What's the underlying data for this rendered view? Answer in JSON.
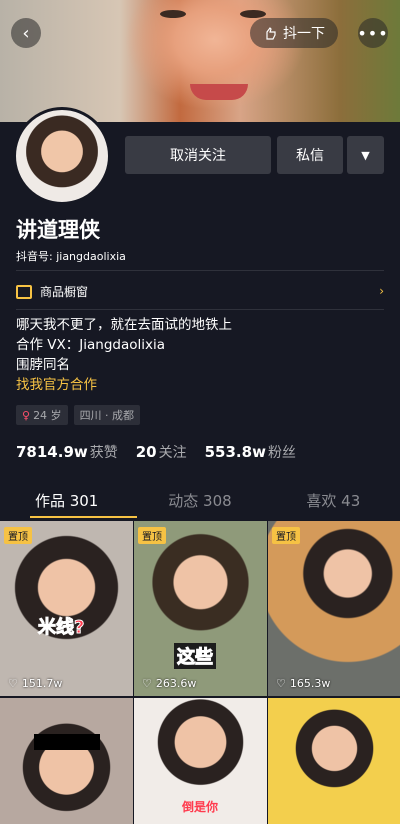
{
  "header": {
    "back_icon": "‹",
    "shake_label": "抖一下",
    "more_icon": "•••"
  },
  "profile": {
    "name": "讲道理侠",
    "douyin_id": "抖音号: jiangdaolixia",
    "buttons": {
      "unfollow": "取消关注",
      "message": "私信",
      "dropdown": "▼"
    },
    "shop_label": "商品橱窗",
    "bio_lines": [
      "哪天我不更了，就在去面试的地铁上",
      "合作 VX：Jiangdaolixia",
      "围脖同名"
    ],
    "bio_link": "找我官方合作",
    "tags": [
      {
        "icon": "♀",
        "label": "24 岁"
      },
      {
        "label": "四川 · 成都"
      }
    ],
    "stats": [
      {
        "value": "7814.9w",
        "label": "获赞"
      },
      {
        "value": "20",
        "label": "关注"
      },
      {
        "value": "553.8w",
        "label": "粉丝"
      }
    ]
  },
  "tabs": [
    {
      "label": "作品 301"
    },
    {
      "label": "动态 308"
    },
    {
      "label": "喜欢 43"
    }
  ],
  "videos": [
    {
      "pin": "置顶",
      "likes": "151.7w",
      "caption": "米线?"
    },
    {
      "pin": "置顶",
      "likes": "263.6w",
      "caption": "这些"
    },
    {
      "pin": "置顶",
      "likes": "165.3w",
      "caption": ""
    },
    {
      "pin": "",
      "likes": "",
      "caption": ""
    },
    {
      "pin": "",
      "likes": "",
      "caption": "倒是你"
    },
    {
      "pin": "",
      "likes": "",
      "caption": ""
    }
  ],
  "colors": {
    "background": "#161823",
    "accent": "#f6c244",
    "button": "#393b44",
    "muted": "#a8a9ad"
  }
}
